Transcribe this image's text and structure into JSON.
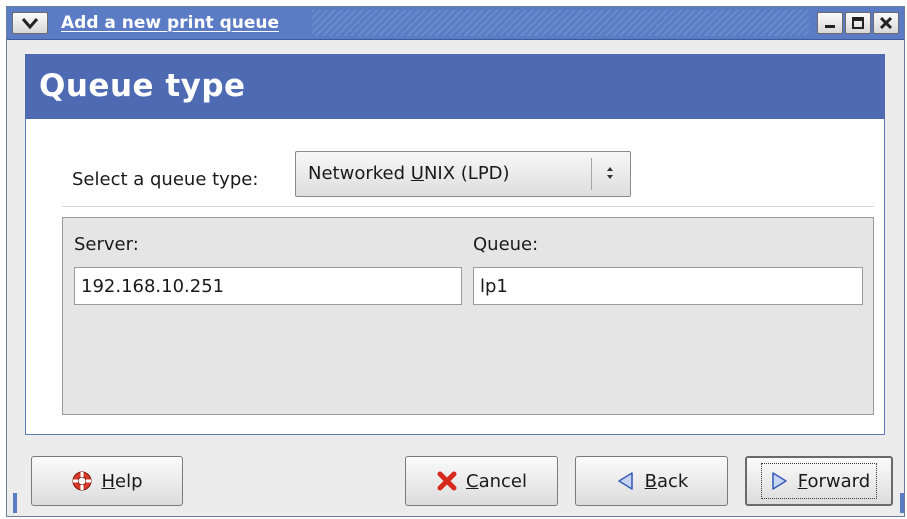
{
  "window": {
    "title": "Add a new print queue"
  },
  "banner": {
    "title": "Queue type"
  },
  "queue_type": {
    "label": "Select a queue type:",
    "selected_value_pre": "Networked ",
    "selected_value_mnemonic": "U",
    "selected_value_post": "NIX (LPD)"
  },
  "fields": {
    "server_label": "Server:",
    "server_value": "192.168.10.251",
    "queue_label": "Queue:",
    "queue_value": "lp1"
  },
  "buttons": {
    "help_mnemonic": "H",
    "help_rest": "elp",
    "cancel_mnemonic": "C",
    "cancel_rest": "ancel",
    "back_mnemonic": "B",
    "back_rest": "ack",
    "forward_mnemonic": "F",
    "forward_rest": "orward"
  },
  "icons": {
    "window_menu": "chevron-down-icon",
    "minimize": "minimize-icon",
    "maximize": "maximize-icon",
    "close": "close-icon",
    "help": "help-lifebuoy-icon",
    "cancel": "cancel-x-icon",
    "back": "back-arrow-icon",
    "forward": "forward-arrow-icon"
  },
  "colors": {
    "titlebar": "#5b7bc4",
    "banner": "#4d6ab3",
    "cancel_icon": "#d62b1c",
    "arrow_icon": "#4a6fc8"
  }
}
